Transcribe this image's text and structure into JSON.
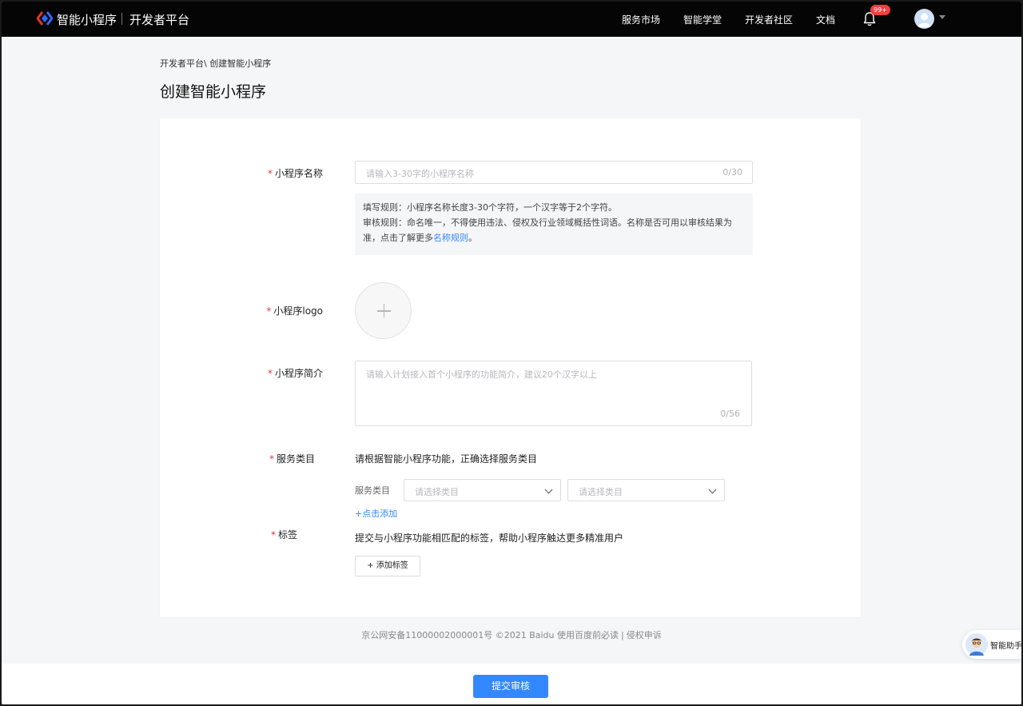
{
  "colors": {
    "accent": "#3388ff",
    "required": "#e53935",
    "nav_bg": "#050505"
  },
  "header": {
    "brand": "智能小程序",
    "platform": "开发者平台",
    "nav": [
      "服务市场",
      "智能学堂",
      "开发者社区",
      "文档"
    ],
    "notifications_badge": "99+",
    "icons": [
      "swan-logo-icon",
      "bell-icon",
      "user-avatar-icon",
      "caret-down-icon"
    ]
  },
  "breadcrumb": "开发者平台\\ 创建智能小程序",
  "page_title": "创建智能小程序",
  "form": {
    "required_mark": "*",
    "name": {
      "label": "小程序名称",
      "placeholder": "请输入3-30字的小程序名称",
      "counter": "0/30"
    },
    "rules": {
      "line1": "填写规则：小程序名称长度3-30个字符，一个汉字等于2个字符。",
      "line2_a": "审核规则：命名唯一，不得使用违法、侵权及行业领域概括性词语。名称是否可用以审核结果为",
      "line2_b": "准，点击了解更多",
      "link": "名称规则",
      "end": "。"
    },
    "logo": {
      "label": "小程序logo"
    },
    "intro": {
      "label": "小程序简介",
      "placeholder": "请输入计划接入首个小程序的功能简介，建议20个汉字以上",
      "counter": "0/56"
    },
    "category": {
      "label": "服务类目",
      "hint": "请根据智能小程序功能，正确选择服务类目",
      "sub_label": "服务类目",
      "select1_placeholder": "请选择类目",
      "select2_placeholder": "请选择类目",
      "add_link": "+点击添加"
    },
    "tags": {
      "label": "标签",
      "hint": "提交与小程序功能相匹配的标签，帮助小程序触达更多精准用户",
      "add_button": "+ 添加标签"
    }
  },
  "footer": {
    "icp": "京公网安备11000002000001号 ©2021 Baidu",
    "terms": "使用百度前必读",
    "separator": "|",
    "report": "侵权申诉"
  },
  "assistant": {
    "label": "智能助手"
  },
  "submit_button": "提交审核"
}
